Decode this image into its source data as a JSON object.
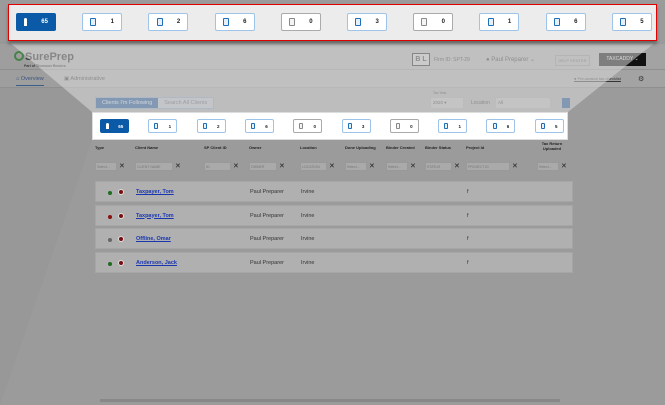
{
  "header": {
    "logo": "SurePrep",
    "logo_sub": "Part of Thomson Reuters",
    "firm_badge": "B L",
    "firm_id": "Firm ID: SPT-29",
    "user": "Paul Preparer",
    "help": "HELP CENTER",
    "taxcaddy": "TAXCADDY"
  },
  "nav": {
    "overview": "Overview",
    "administrative": "Administrative",
    "checklist": "Pre-season tax checklist"
  },
  "tabs": {
    "following": "Clients I'm Following",
    "search": "Search All Clients"
  },
  "filters": {
    "tax_year_label": "Tax Year",
    "tax_year": "2020",
    "location_label": "Location",
    "location": "All"
  },
  "status_buttons": [
    {
      "icon": "person-icon",
      "count": "65",
      "style": "blue"
    },
    {
      "icon": "comment-icon",
      "count": "1"
    },
    {
      "icon": "clipboard-icon",
      "count": "2"
    },
    {
      "icon": "document-icon",
      "count": "6"
    },
    {
      "icon": "document-edit-icon",
      "count": "0",
      "style": "gray"
    },
    {
      "icon": "document-arrow-icon",
      "count": "3"
    },
    {
      "icon": "document-check-icon",
      "count": "0",
      "style": "gray"
    },
    {
      "icon": "binder-icon",
      "count": "1"
    },
    {
      "icon": "document-upload-icon",
      "count": "6"
    },
    {
      "icon": "document-info-icon",
      "count": "5"
    }
  ],
  "columns": [
    "Type",
    "Client Name",
    "SP Client ID",
    "Owner",
    "Location",
    "Done Uploading",
    "Binder Created",
    "Binder Status",
    "Project Id",
    "Tax Return Uploaded"
  ],
  "column_filters": [
    "Select...",
    "CLIENT NAME",
    "ID",
    "OWNER",
    "LOCATION",
    "Select...",
    "Select...",
    "STATUS",
    "PROJECT ID",
    "Select..."
  ],
  "rows": [
    {
      "dot": "#1f6b1f",
      "name": "Taxpayer, Tom",
      "owner": "Paul Preparer",
      "location": "Irvine",
      "project": "f"
    },
    {
      "dot": "#8a1010",
      "name": "Taxpayer, Tom",
      "owner": "Paul Preparer",
      "location": "Irvine",
      "project": "f"
    },
    {
      "dot": "#666666",
      "name": "Offline, Omar",
      "owner": "Paul Preparer",
      "location": "Irvine",
      "project": "f"
    },
    {
      "dot": "#1f6b1f",
      "name": "Anderson, Jack",
      "owner": "Paul Preparer",
      "location": "Irvine",
      "project": "f"
    }
  ]
}
